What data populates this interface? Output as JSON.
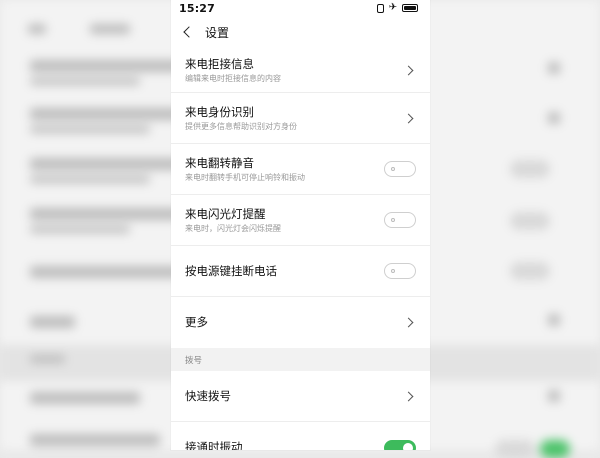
{
  "status_bar": {
    "time": "15:27",
    "icons": [
      "vibrate-icon",
      "airplane-icon",
      "battery-icon"
    ]
  },
  "header": {
    "title": "设置",
    "back_icon": "chevron-left-icon"
  },
  "settings": [
    {
      "title": "来电拒接信息",
      "subtitle": "编辑来电时拒接信息的内容",
      "control": "chevron"
    },
    {
      "title": "来电身份识别",
      "subtitle": "提供更多信息帮助识别对方身份",
      "control": "chevron"
    },
    {
      "title": "来电翻转静音",
      "subtitle": "来电时翻转手机可停止响铃和振动",
      "control": "switch",
      "on": false
    },
    {
      "title": "来电闪光灯提醒",
      "subtitle": "来电时，闪光灯会闪烁提醒",
      "control": "switch",
      "on": false
    },
    {
      "title": "按电源键挂断电话",
      "subtitle": "",
      "control": "switch",
      "on": false
    },
    {
      "title": "更多",
      "subtitle": "",
      "control": "chevron"
    }
  ],
  "section_dial": {
    "label": "拨号",
    "items": [
      {
        "title": "快速拨号",
        "control": "chevron"
      },
      {
        "title": "接通时振动",
        "control": "switch",
        "on": true
      }
    ]
  },
  "colors": {
    "accent_switch_on": "#3dbb5c",
    "text_primary": "#111111",
    "text_secondary": "#999999",
    "section_background": "#f2f2f2"
  }
}
